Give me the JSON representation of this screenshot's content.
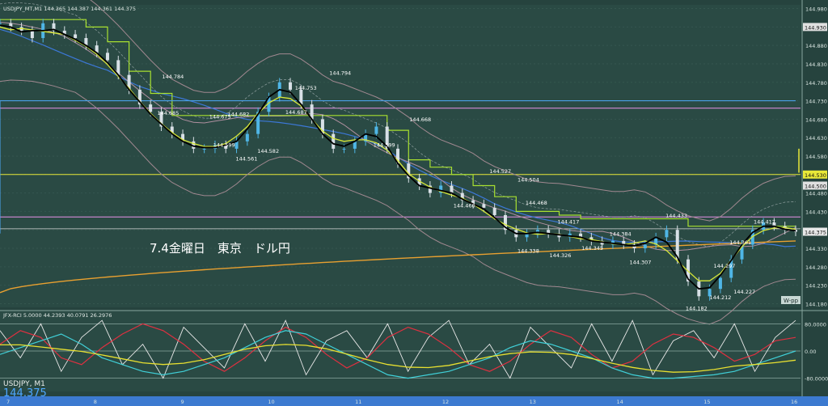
{
  "window": {
    "symbol_header": "USDJPY_MT,M1  144.365 144.387 144.361 144.375",
    "indicator_header": "JFX-RCI 5.0000 44.2393 40.0791 26.2976",
    "watermark_symbol": "USDJPY, M1",
    "watermark_price": "144.375",
    "annotation_text": "7.4金曜日　東京　ドル円",
    "wpp_label": "W-pp",
    "current_price_tag": "144.375",
    "marker_530": "144.530",
    "marker_930": "144.930",
    "marker_500": "144.500"
  },
  "colors": {
    "background": "#2a4a44",
    "candle_up": "#4fb6e6",
    "candle_down": "#d8e0e6",
    "ma_black": "#000000",
    "ma_yellow": "#d8e838",
    "ma_gold": "#e8a030",
    "ma_blue": "#3c78d8",
    "ma_green_step": "#a8e030",
    "ma_purple_step": "#b090a0",
    "hline_pink": "#e890e8",
    "hline_yellow": "#e8e838"
  },
  "chart_data": [
    {
      "type": "line",
      "title": "USDJPY_MT,M1",
      "yaxis_ticks": [
        "144.980",
        "144.930",
        "144.880",
        "144.830",
        "144.780",
        "144.730",
        "144.680",
        "144.630",
        "144.580",
        "144.530",
        "144.480",
        "144.430",
        "144.380",
        "144.330",
        "144.280",
        "144.230",
        "144.180"
      ],
      "xaxis_ticks": [
        "7",
        "8",
        "9",
        "10",
        "11",
        "12",
        "13",
        "14",
        "15",
        "16"
      ],
      "ylim": [
        144.17,
        144.99
      ],
      "price_labels": [
        {
          "text": "144.784",
          "x": 0.216,
          "y": 144.784
        },
        {
          "text": "144.685",
          "x": 0.21,
          "y": 144.685
        },
        {
          "text": "144.675",
          "x": 0.275,
          "y": 144.675
        },
        {
          "text": "144.682",
          "x": 0.298,
          "y": 144.682
        },
        {
          "text": "144.599",
          "x": 0.28,
          "y": 144.599
        },
        {
          "text": "144.561",
          "x": 0.308,
          "y": 144.561
        },
        {
          "text": "144.582",
          "x": 0.335,
          "y": 144.582
        },
        {
          "text": "144.753",
          "x": 0.382,
          "y": 144.753
        },
        {
          "text": "144.687",
          "x": 0.37,
          "y": 144.687
        },
        {
          "text": "144.794",
          "x": 0.425,
          "y": 144.794
        },
        {
          "text": "144.599",
          "x": 0.48,
          "y": 144.599
        },
        {
          "text": "144.668",
          "x": 0.525,
          "y": 144.668
        },
        {
          "text": "144.527",
          "x": 0.625,
          "y": 144.527
        },
        {
          "text": "144.504",
          "x": 0.66,
          "y": 144.504
        },
        {
          "text": "144.460",
          "x": 0.58,
          "y": 144.46
        },
        {
          "text": "144.468",
          "x": 0.67,
          "y": 144.468
        },
        {
          "text": "144.417",
          "x": 0.71,
          "y": 144.417
        },
        {
          "text": "144.338",
          "x": 0.66,
          "y": 144.338
        },
        {
          "text": "144.326",
          "x": 0.7,
          "y": 144.326
        },
        {
          "text": "144.384",
          "x": 0.775,
          "y": 144.384
        },
        {
          "text": "144.345",
          "x": 0.74,
          "y": 144.345
        },
        {
          "text": "144.307",
          "x": 0.8,
          "y": 144.307
        },
        {
          "text": "144.433",
          "x": 0.845,
          "y": 144.433
        },
        {
          "text": "144.297",
          "x": 0.905,
          "y": 144.297
        },
        {
          "text": "144.227",
          "x": 0.93,
          "y": 144.227
        },
        {
          "text": "144.212",
          "x": 0.9,
          "y": 144.212
        },
        {
          "text": "144.182",
          "x": 0.87,
          "y": 144.182
        },
        {
          "text": "144.417",
          "x": 0.955,
          "y": 144.417
        },
        {
          "text": "144.361",
          "x": 0.925,
          "y": 144.361
        }
      ],
      "series": [
        {
          "name": "price",
          "values": [
            144.94,
            144.93,
            144.92,
            144.9,
            144.94,
            144.92,
            144.91,
            144.9,
            144.88,
            144.86,
            144.84,
            144.8,
            144.76,
            144.72,
            144.7,
            144.66,
            144.64,
            144.62,
            144.6,
            144.6,
            144.61,
            144.6,
            144.62,
            144.64,
            144.7,
            144.74,
            144.78,
            144.76,
            144.72,
            144.68,
            144.64,
            144.6,
            144.6,
            144.62,
            144.64,
            144.66,
            144.6,
            144.56,
            144.52,
            144.5,
            144.48,
            144.5,
            144.48,
            144.46,
            144.45,
            144.44,
            144.42,
            144.38,
            144.36,
            144.37,
            144.38,
            144.37,
            144.36,
            144.37,
            144.36,
            144.35,
            144.34,
            144.35,
            144.34,
            144.33,
            144.34,
            144.36,
            144.38,
            144.3,
            144.24,
            144.2,
            144.22,
            144.25,
            144.3,
            144.34,
            144.38,
            144.4,
            144.39,
            144.38,
            144.375
          ]
        }
      ]
    },
    {
      "type": "line",
      "title": "JFX-RCI",
      "ylim": [
        -100,
        100
      ],
      "yaxis_ticks": [
        "80.0000",
        "0.00",
        "-80.0000"
      ],
      "series": [
        {
          "name": "RCI 5",
          "values": [
            60,
            -20,
            80,
            -60,
            40,
            90,
            -40,
            20,
            -80,
            70,
            10,
            -50,
            80,
            -30,
            90,
            -70,
            30,
            60,
            -20,
            80,
            -60,
            40,
            90,
            -40,
            20,
            -80,
            70,
            10,
            -50,
            80,
            -30,
            90,
            -70,
            30,
            60,
            -20,
            80,
            -60,
            40,
            90
          ]
        },
        {
          "name": "RCI 44",
          "values": [
            20,
            60,
            40,
            -20,
            -40,
            10,
            50,
            80,
            60,
            20,
            -30,
            -60,
            -20,
            30,
            70,
            40,
            -10,
            -50,
            -20,
            40,
            70,
            50,
            10,
            -40,
            -60,
            -30,
            20,
            60,
            40,
            -10,
            -50,
            -30,
            20,
            50,
            40,
            10,
            -30,
            -10,
            30,
            40
          ]
        },
        {
          "name": "RCI 26",
          "values": [
            -10,
            10,
            30,
            50,
            20,
            -20,
            -40,
            -60,
            -70,
            -60,
            -40,
            -20,
            10,
            40,
            60,
            50,
            20,
            -10,
            -40,
            -70,
            -80,
            -70,
            -60,
            -40,
            -20,
            10,
            30,
            20,
            0,
            -20,
            -50,
            -70,
            -80,
            -80,
            -75,
            -70,
            -60,
            -40,
            -20,
            0
          ]
        }
      ]
    }
  ]
}
